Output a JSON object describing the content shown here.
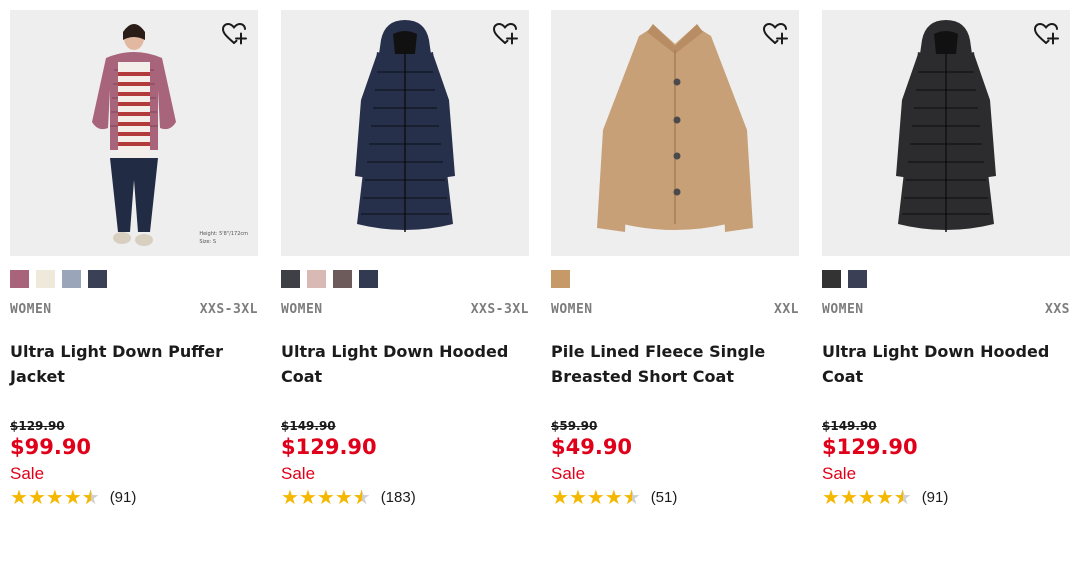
{
  "products": [
    {
      "category": "WOMEN",
      "size_range": "XXS-3XL",
      "name": "Ultra Light Down Puffer Jacket",
      "original_price": "$129.90",
      "price": "$99.90",
      "sale_label": "Sale",
      "rating": 4.5,
      "review_count": "(91)",
      "model_note": [
        "Height: 5'8\"/172cm",
        "Size: S"
      ],
      "swatches": [
        "#a8647b",
        "#efe9dc",
        "#9aa5ba",
        "#3a4056"
      ],
      "garment": "puffer-jacket",
      "garment_color": "#a8647b"
    },
    {
      "category": "WOMEN",
      "size_range": "XXS-3XL",
      "name": "Ultra Light Down Hooded Coat",
      "original_price": "$149.90",
      "price": "$129.90",
      "sale_label": "Sale",
      "rating": 4.5,
      "review_count": "(183)",
      "swatches": [
        "#3e4045",
        "#d8b9b3",
        "#6d5a5a",
        "#323a52"
      ],
      "garment": "long-coat",
      "garment_color": "#26304a"
    },
    {
      "category": "WOMEN",
      "size_range": "XXL",
      "name": "Pile Lined Fleece Single Breasted Short Coat",
      "original_price": "$59.90",
      "price": "$49.90",
      "sale_label": "Sale",
      "rating": 4.5,
      "review_count": "(51)",
      "swatches": [
        "#c59a68"
      ],
      "garment": "fleece-coat",
      "garment_color": "#c8a078"
    },
    {
      "category": "WOMEN",
      "size_range": "XXS",
      "name": "Ultra Light Down Hooded Coat",
      "original_price": "$149.90",
      "price": "$129.90",
      "sale_label": "Sale",
      "rating": 4.5,
      "review_count": "(91)",
      "swatches": [
        "#333333",
        "#3a3f55"
      ],
      "garment": "long-coat",
      "garment_color": "#2c2c2e"
    }
  ],
  "icons": {
    "wishlist": "heart-plus-icon",
    "rating": "star-icon"
  },
  "colors": {
    "sale": "#e0001a",
    "star": "#f5b800",
    "image_bg": "#eeeeee"
  }
}
